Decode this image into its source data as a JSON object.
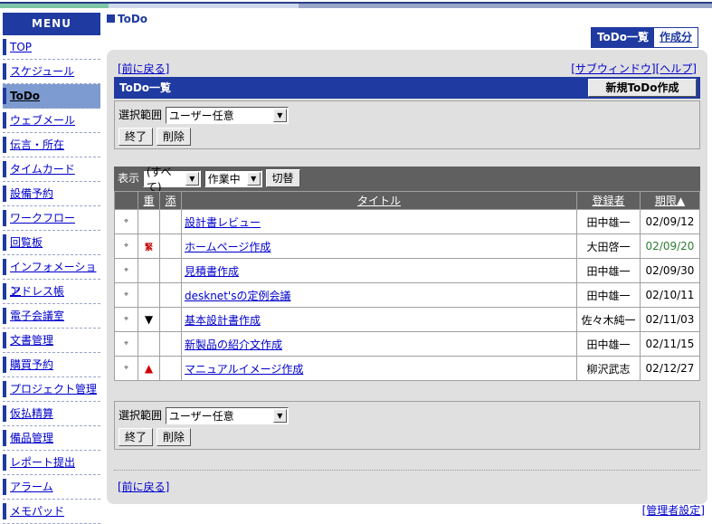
{
  "sidebar": {
    "title": "MENU",
    "items": [
      {
        "label": "TOP"
      },
      {
        "label": "スケジュール"
      },
      {
        "label": "ToDo"
      },
      {
        "label": "ウェブメール"
      },
      {
        "label": "伝言・所在"
      },
      {
        "label": "タイムカード"
      },
      {
        "label": "設備予約"
      },
      {
        "label": "ワークフロー"
      },
      {
        "label": "回覧板"
      },
      {
        "label": "インフォメーション"
      },
      {
        "label": "アドレス帳"
      },
      {
        "label": "電子会議室"
      },
      {
        "label": "文書管理"
      },
      {
        "label": "購買予約"
      },
      {
        "label": "プロジェクト管理"
      },
      {
        "label": "仮払精算"
      },
      {
        "label": "備品管理"
      },
      {
        "label": "レポート提出"
      },
      {
        "label": "アラーム"
      },
      {
        "label": "メモパッド"
      }
    ]
  },
  "header": {
    "page_title": "ToDo",
    "tab_list": "ToDo一覧",
    "tab_create": "作成分"
  },
  "links": {
    "back": "[前に戻る]",
    "subwindow": "[サブウィンドウ]",
    "help": "[ヘルプ]",
    "admin": "[管理者設定]"
  },
  "list_section": {
    "title": "ToDo一覧",
    "new_button": "新規ToDo作成",
    "range_label": "選択範囲",
    "range_value": "ユーザー任意",
    "finish_button": "終了",
    "delete_button": "削除"
  },
  "filter": {
    "display_label": "表示",
    "display_value": "(すべて)",
    "status_value": "作業中",
    "switch_button": "切替"
  },
  "table": {
    "headers": {
      "priority": "重",
      "attach": "添",
      "title": "タイトル",
      "registrant": "登録者",
      "due": "期限▲"
    },
    "rows": [
      {
        "title": "設計書レビュー",
        "priority": "",
        "registrant": "田中雄一",
        "due": "02/09/12",
        "due_color": "normal"
      },
      {
        "title": "ホームページ作成",
        "priority": "緊",
        "registrant": "大田啓一",
        "due": "02/09/20",
        "due_color": "green"
      },
      {
        "title": "見積書作成",
        "priority": "",
        "registrant": "田中雄一",
        "due": "02/09/30",
        "due_color": "normal"
      },
      {
        "title": "desknet'sの定例会議",
        "priority": "",
        "registrant": "田中雄一",
        "due": "02/10/11",
        "due_color": "normal"
      },
      {
        "title": "基本設計書作成",
        "priority": "▼",
        "registrant": "佐々木純一",
        "due": "02/11/03",
        "due_color": "normal"
      },
      {
        "title": "新製品の紹介文作成",
        "priority": "",
        "registrant": "田中雄一",
        "due": "02/11/15",
        "due_color": "normal"
      },
      {
        "title": "マニュアルイメージ作成",
        "priority": "▲",
        "registrant": "柳沢武志",
        "due": "02/12/27",
        "due_color": "normal"
      }
    ]
  },
  "colors": {
    "accent": "#1f3aa0",
    "panel": "#e0e0e0",
    "header_gray": "#606060",
    "due_green": "#2e7d32",
    "priority_red": "#d00000"
  }
}
